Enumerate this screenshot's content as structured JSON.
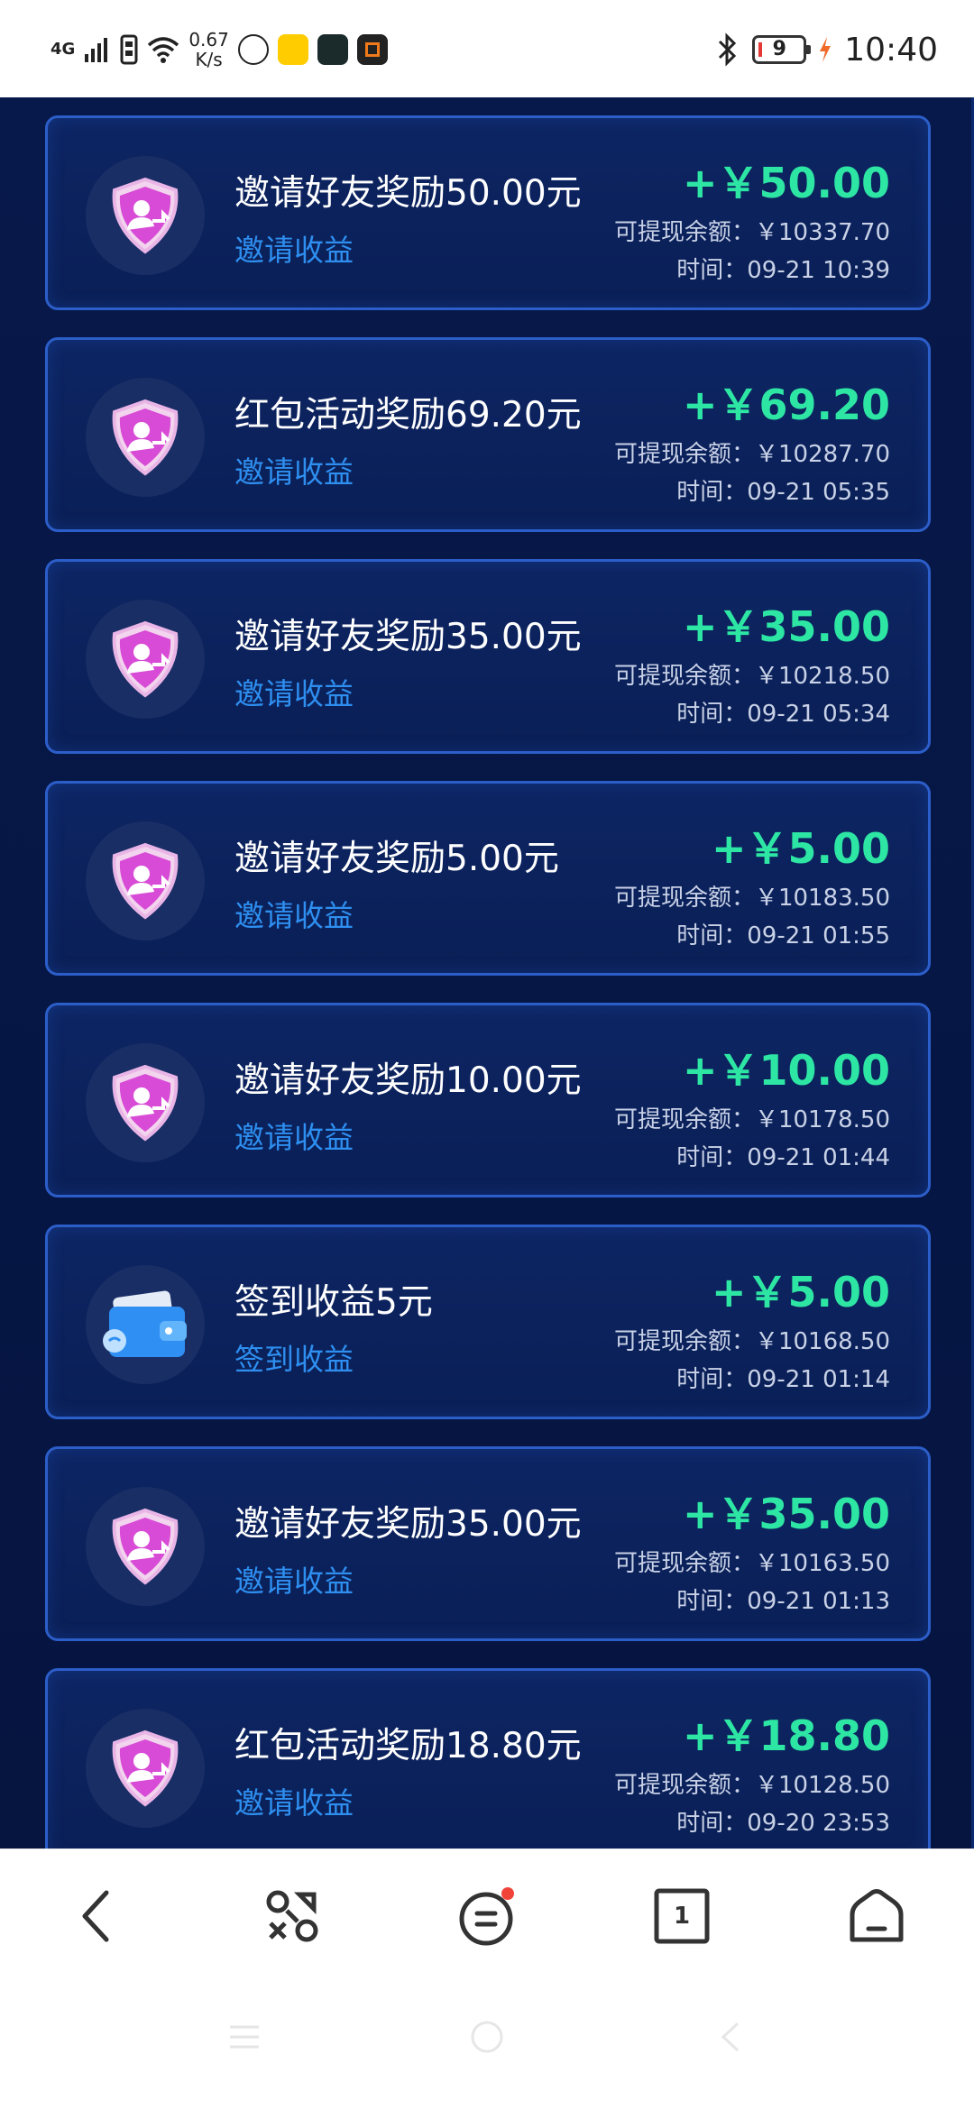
{
  "status_bar": {
    "network": "4G",
    "speed_value": "0.67",
    "speed_unit": "K/s",
    "battery": "9",
    "time": "10:40"
  },
  "colors": {
    "background": "#07194a",
    "card_border": "#2c5ec9",
    "amount": "#2ee6a4",
    "subtitle": "#2e8ff0"
  },
  "records": [
    {
      "icon": "invite-shield-icon",
      "title": "邀请好友奖励50.00元",
      "subtitle": "邀请收益",
      "amount": "+￥50.00",
      "balance": "可提现余额：￥10337.70",
      "time": "时间：09-21 10:39"
    },
    {
      "icon": "invite-shield-icon",
      "title": "红包活动奖励69.20元",
      "subtitle": "邀请收益",
      "amount": "+￥69.20",
      "balance": "可提现余额：￥10287.70",
      "time": "时间：09-21 05:35"
    },
    {
      "icon": "invite-shield-icon",
      "title": "邀请好友奖励35.00元",
      "subtitle": "邀请收益",
      "amount": "+￥35.00",
      "balance": "可提现余额：￥10218.50",
      "time": "时间：09-21 05:34"
    },
    {
      "icon": "invite-shield-icon",
      "title": "邀请好友奖励5.00元",
      "subtitle": "邀请收益",
      "amount": "+￥5.00",
      "balance": "可提现余额：￥10183.50",
      "time": "时间：09-21 01:55"
    },
    {
      "icon": "invite-shield-icon",
      "title": "邀请好友奖励10.00元",
      "subtitle": "邀请收益",
      "amount": "+￥10.00",
      "balance": "可提现余额：￥10178.50",
      "time": "时间：09-21 01:44"
    },
    {
      "icon": "wallet-icon",
      "title": "签到收益5元",
      "subtitle": "签到收益",
      "amount": "+￥5.00",
      "balance": "可提现余额：￥10168.50",
      "time": "时间：09-21 01:14"
    },
    {
      "icon": "invite-shield-icon",
      "title": "邀请好友奖励35.00元",
      "subtitle": "邀请收益",
      "amount": "+￥35.00",
      "balance": "可提现余额：￥10163.50",
      "time": "时间：09-21 01:13"
    },
    {
      "icon": "invite-shield-icon",
      "title": "红包活动奖励18.80元",
      "subtitle": "邀请收益",
      "amount": "+￥18.80",
      "balance": "可提现余额：￥10128.50",
      "time": "时间：09-20 23:53"
    }
  ],
  "bottom_nav": {
    "items": [
      "back-icon",
      "apps-icon",
      "menu-icon",
      "tabs-icon",
      "home-icon"
    ],
    "tabs_count": "1"
  },
  "system_nav": {
    "items": [
      "recents-icon",
      "home-circle-icon",
      "back-triangle-icon"
    ]
  }
}
